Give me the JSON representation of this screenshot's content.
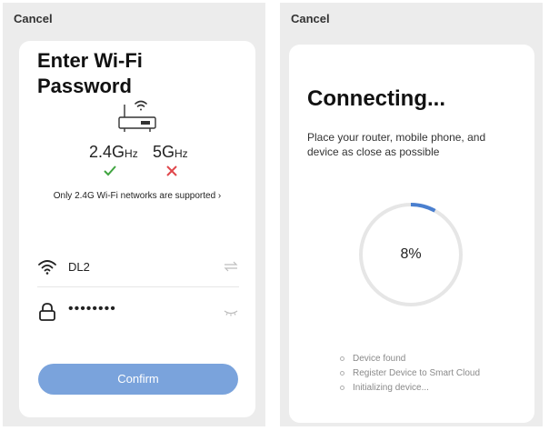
{
  "left_screen": {
    "cancel_label": "Cancel",
    "title_line1": "Enter Wi-Fi",
    "title_line2": "Password",
    "band_24": {
      "value": "2.4G",
      "unit": "Hz",
      "supported": true
    },
    "band_5": {
      "value": "5G",
      "unit": "Hz",
      "supported": false
    },
    "only_note": "Only 2.4G Wi-Fi networks are supported",
    "ssid": "DL2",
    "password_masked": "••••••••",
    "confirm_label": "Confirm",
    "colors": {
      "confirm": "#7aa3dc",
      "check": "#3fa43f",
      "cross": "#e0474c"
    },
    "icons": [
      "router-icon",
      "wifi-icon",
      "check-icon",
      "cross-icon",
      "chevron-right-icon",
      "swap-icon",
      "lock-icon",
      "eye-closed-icon"
    ]
  },
  "right_screen": {
    "cancel_label": "Cancel",
    "title": "Connecting...",
    "description": "Place your router, mobile phone, and device as close as possible",
    "progress_label": "8%",
    "progress_fraction": 0.08,
    "steps": [
      {
        "label": "Device found"
      },
      {
        "label": "Register Device to Smart Cloud"
      },
      {
        "label": "Initializing device..."
      }
    ],
    "colors": {
      "progress": "#4a7fcf",
      "ring": "#e6e6e6"
    }
  }
}
